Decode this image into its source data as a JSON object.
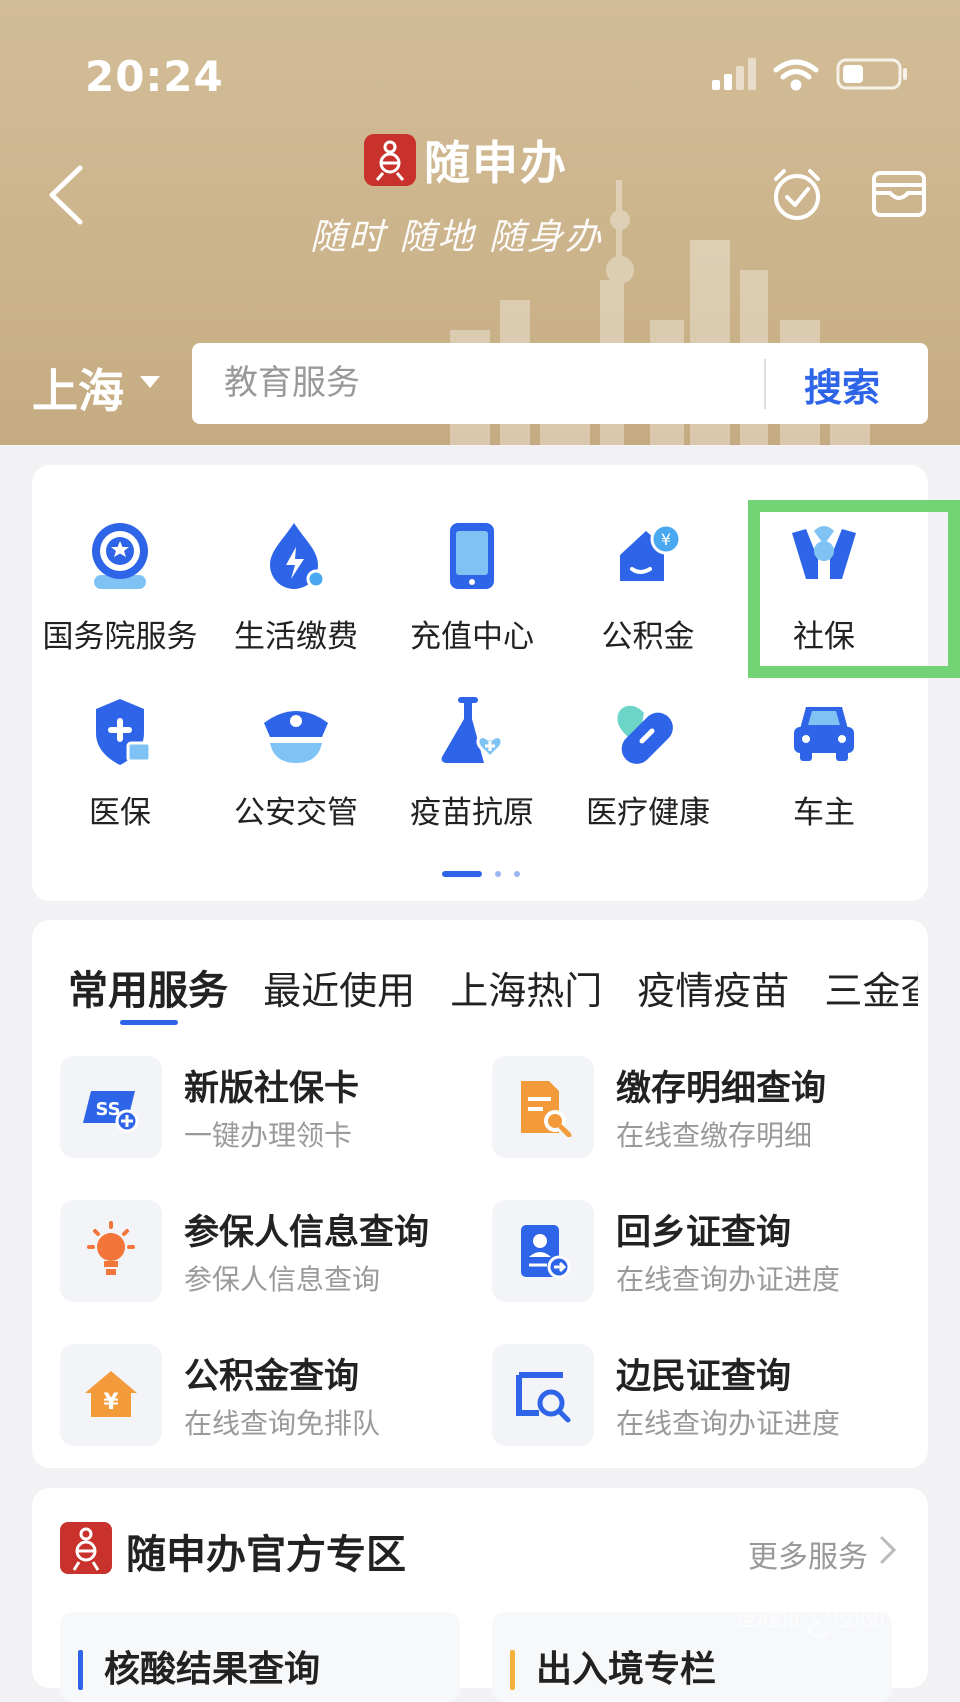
{
  "status_bar": {
    "time": "20:24"
  },
  "header": {
    "app_name": "随申办",
    "slogan": "随时 随地 随身办",
    "city": "上海"
  },
  "search": {
    "placeholder": "教育服务",
    "button": "搜索"
  },
  "quick_grid": {
    "items": [
      {
        "label": "国务院服务",
        "icon": "state-council-icon"
      },
      {
        "label": "生活缴费",
        "icon": "utility-payment-icon"
      },
      {
        "label": "充值中心",
        "icon": "phone-recharge-icon"
      },
      {
        "label": "公积金",
        "icon": "housing-fund-icon"
      },
      {
        "label": "社保",
        "icon": "social-security-icon",
        "highlighted": true
      },
      {
        "label": "医保",
        "icon": "medical-insurance-icon"
      },
      {
        "label": "公安交管",
        "icon": "police-cap-icon"
      },
      {
        "label": "疫苗抗原",
        "icon": "vaccine-flask-icon"
      },
      {
        "label": "医疗健康",
        "icon": "health-pill-icon"
      },
      {
        "label": "车主",
        "icon": "car-icon"
      }
    ],
    "page": 1,
    "page_count": 3
  },
  "services": {
    "tabs": [
      "常用服务",
      "最近使用",
      "上海热门",
      "疫情疫苗",
      "三金查询"
    ],
    "active_tab": 0,
    "items": [
      {
        "title": "新版社保卡",
        "subtitle": "一键办理领卡",
        "icon": "ss-card-icon"
      },
      {
        "title": "缴存明细查询",
        "subtitle": "在线查缴存明细",
        "icon": "document-search-icon"
      },
      {
        "title": "参保人信息查询",
        "subtitle": "参保人信息查询",
        "icon": "lightbulb-icon"
      },
      {
        "title": "回乡证查询",
        "subtitle": "在线查询办证进度",
        "icon": "id-card-icon"
      },
      {
        "title": "公积金查询",
        "subtitle": "在线查询免排队",
        "icon": "yuan-house-icon"
      },
      {
        "title": "边民证查询",
        "subtitle": "在线查询办证进度",
        "icon": "window-search-icon"
      }
    ]
  },
  "official": {
    "title": "随申办官方专区",
    "more": "更多服务",
    "cards": [
      "核酸结果查询",
      "出入境专栏"
    ]
  },
  "colors": {
    "accent": "#2d64e8",
    "highlight": "#71d373",
    "brand_red": "#c8312c",
    "header_gold": "#cbb38b"
  }
}
